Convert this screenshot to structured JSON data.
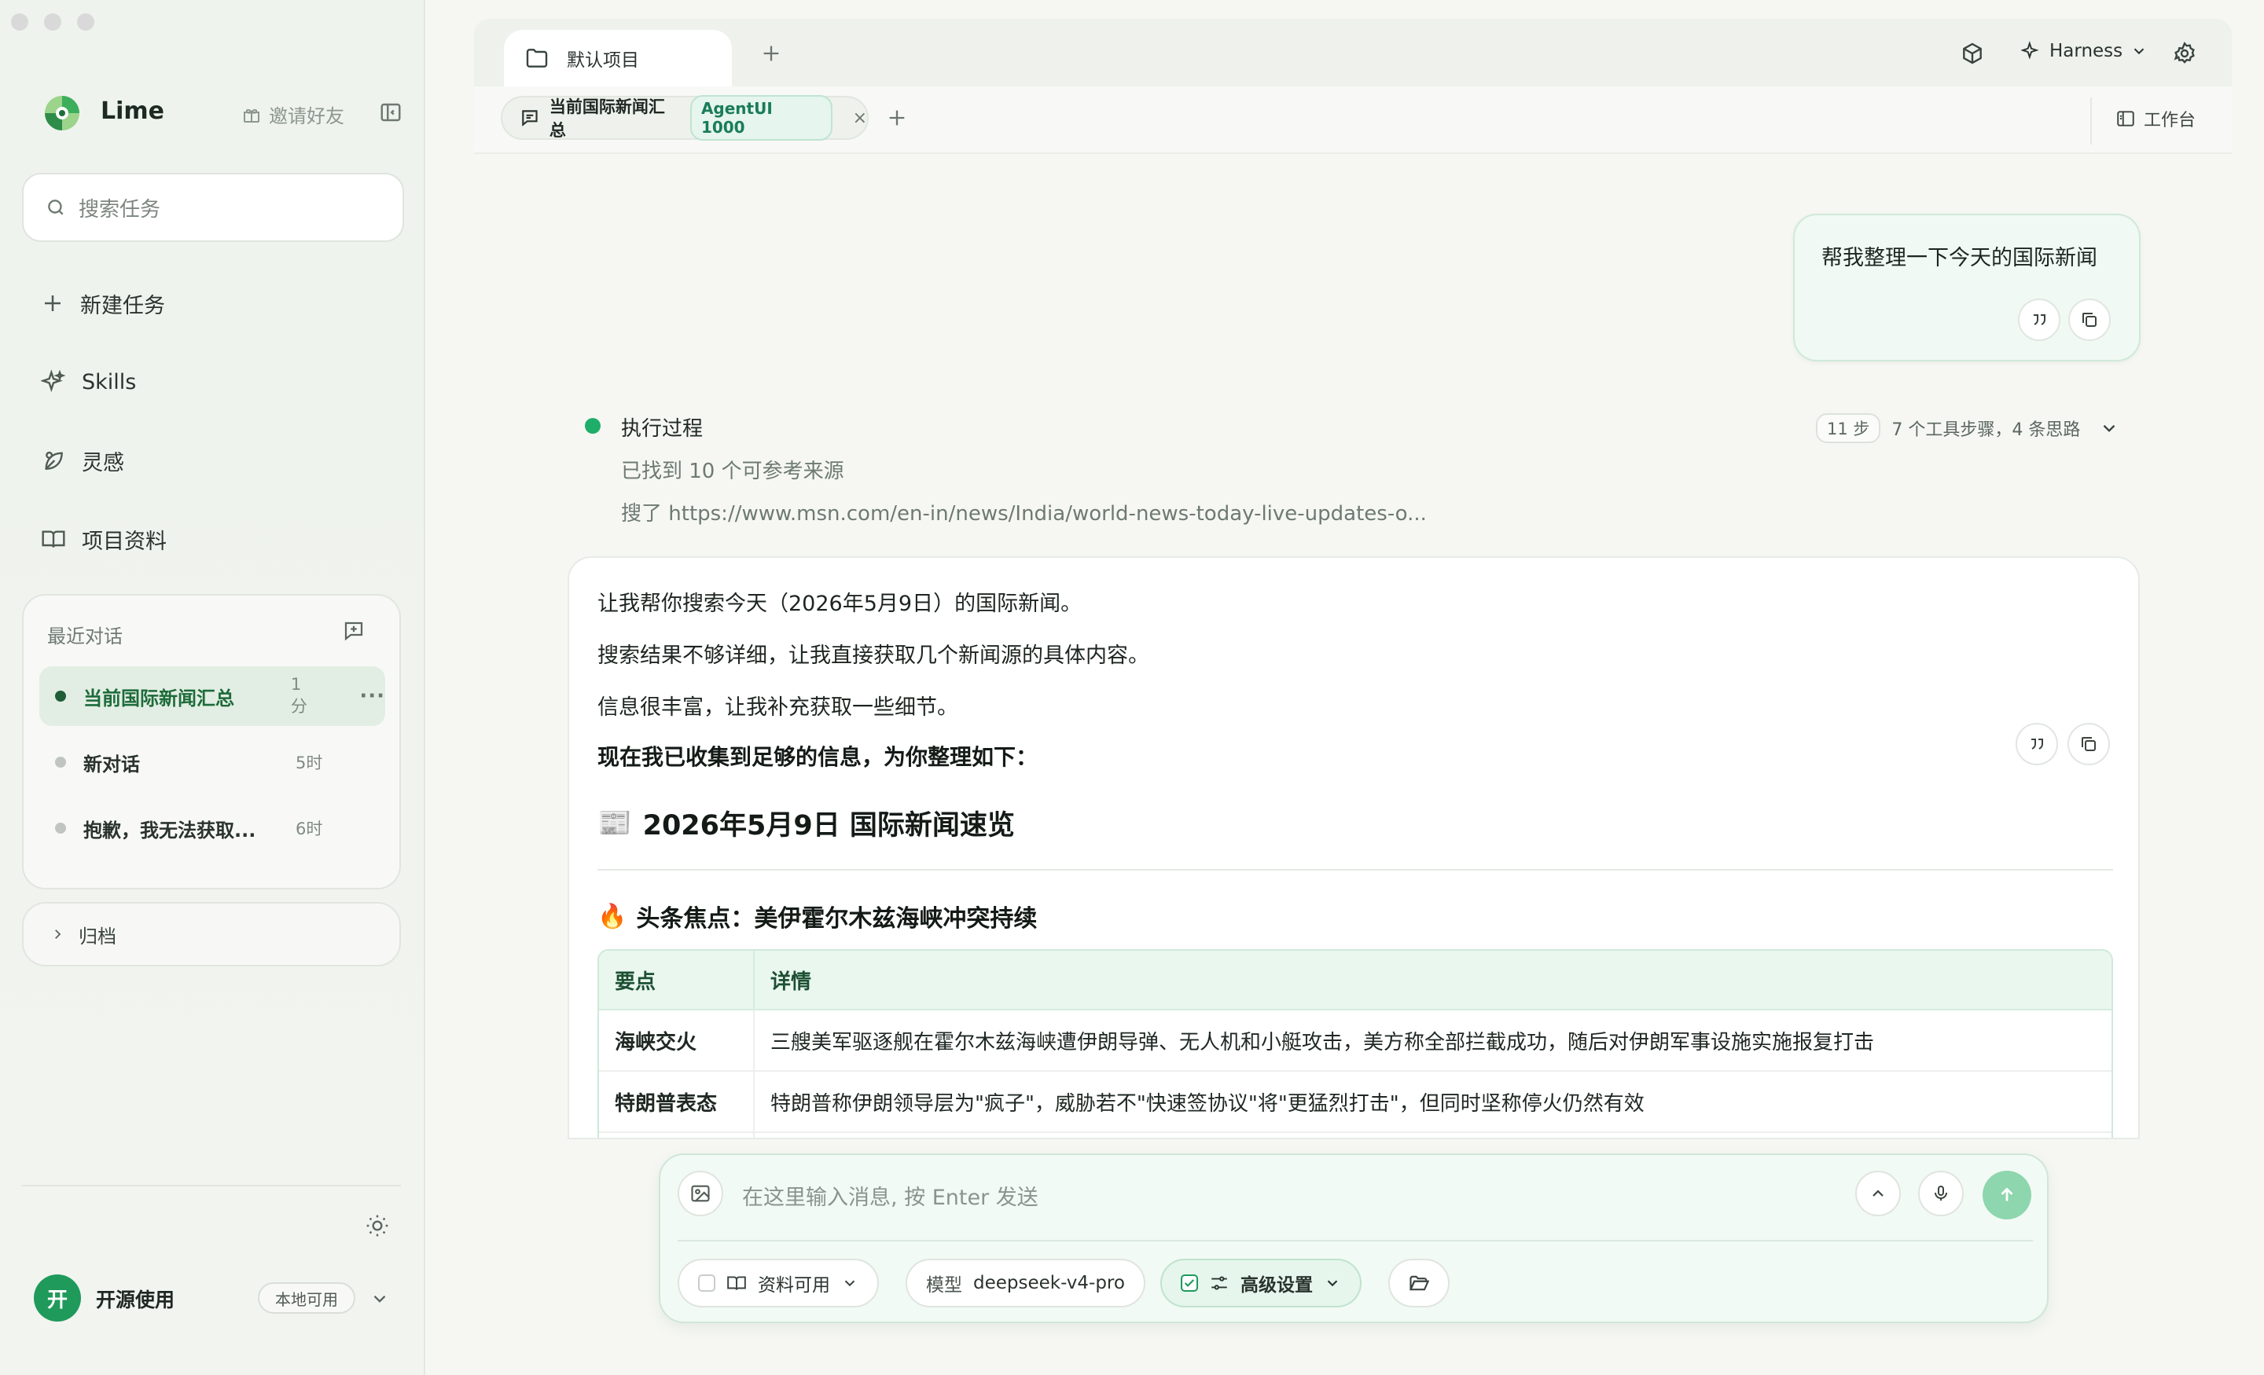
{
  "sidebar": {
    "app_name": "Lime",
    "invite_label": "邀请好友",
    "search_placeholder": "搜索任务",
    "nav": [
      {
        "label": "新建任务"
      },
      {
        "label": "Skills"
      },
      {
        "label": "灵感"
      },
      {
        "label": "项目资料"
      }
    ],
    "recent_title": "最近对话",
    "conversations": [
      {
        "title": "当前国际新闻汇总",
        "time": "1分",
        "more": "···"
      },
      {
        "title": "新对话",
        "time": "5时"
      },
      {
        "title": "抱歉，我无法获取...",
        "time": "6时"
      }
    ],
    "archive_label": "归档",
    "user": {
      "avatar_initial": "开",
      "name": "开源使用",
      "badge": "本地可用"
    }
  },
  "header": {
    "project_tab": "默认项目",
    "harness_label": "Harness",
    "chat_tab": {
      "title": "当前国际新闻汇总",
      "badge": "AgentUI 1000",
      "close": "×"
    },
    "workbench_label": "工作台"
  },
  "chat": {
    "user_message": "帮我整理一下今天的国际新闻",
    "execution": {
      "title": "执行过程",
      "steps_badge": "11 步",
      "steps_summary": "7 个工具步骤，4 条思路",
      "lines": [
        "已找到 10 个可参考来源",
        "搜了 https://www.msn.com/en-in/news/India/world-news-today-live-updates-o..."
      ]
    },
    "answer": {
      "paragraphs": [
        "让我帮你搜索今天（2026年5月9日）的国际新闻。",
        "搜索结果不够详细，让我直接获取几个新闻源的具体内容。",
        "信息很丰富，让我补充获取一些细节。"
      ],
      "bold_line": "现在我已收集到足够的信息，为你整理如下：",
      "heading_emoji": "📰",
      "heading": "2026年5月9日 国际新闻速览",
      "subheading_emoji": "🔥",
      "subheading": "头条焦点：美伊霍尔木兹海峡冲突持续",
      "table": {
        "headers": [
          "要点",
          "详情"
        ],
        "rows": [
          [
            "海峡交火",
            "三艘美军驱逐舰在霍尔木兹海峡遭伊朗导弹、无人机和小艇攻击，美方称全部拦截成功，随后对伊朗军事设施实施报复打击"
          ],
          [
            "特朗普表态",
            "特朗普称伊朗领导层为\"疯子\"，威胁若不\"快速签协议\"将\"更猛烈打击\"，但同时坚称停火仍然有效"
          ]
        ]
      }
    }
  },
  "composer": {
    "placeholder": "在这里输入消息, 按 Enter 发送",
    "materials_label": "资料可用",
    "model_label": "模型",
    "model_value": "deepseek-v4-pro",
    "advanced_label": "高级设置"
  },
  "colors": {
    "accent": "#1fae69",
    "active_bg": "#e2eee3",
    "table_header": "#e9f7ee"
  }
}
